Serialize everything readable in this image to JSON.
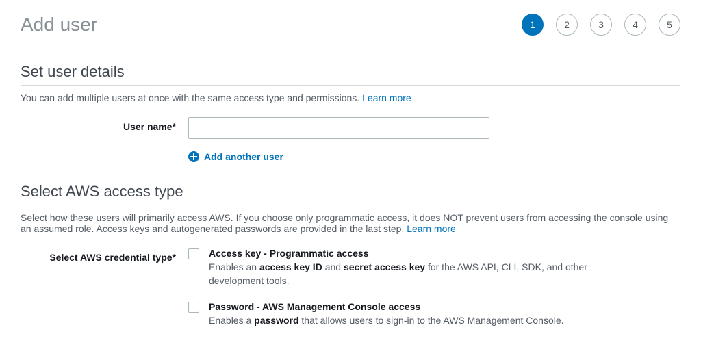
{
  "page_title": "Add user",
  "stepper": {
    "active": 1,
    "steps": [
      "1",
      "2",
      "3",
      "4",
      "5"
    ]
  },
  "user_details": {
    "title": "Set user details",
    "subtitle_prefix": "You can add multiple users at once with the same access type and permissions. ",
    "learn_more": "Learn more",
    "username_label": "User name*",
    "username_value": "",
    "add_another_label": "Add another user"
  },
  "access_type": {
    "title": "Select AWS access type",
    "subtitle_prefix": "Select how these users will primarily access AWS. If you choose only programmatic access, it does NOT prevent users from accessing the console using an assumed role. Access keys and autogenerated passwords are provided in the last step. ",
    "learn_more": "Learn more",
    "credential_label": "Select AWS credential type*",
    "option_access_key": {
      "title": "Access key - Programmatic access",
      "desc_prefix": "Enables an ",
      "desc_b1": "access key ID",
      "desc_mid": " and ",
      "desc_b2": "secret access key",
      "desc_suffix": " for the AWS API, CLI, SDK, and other development tools."
    },
    "option_password": {
      "title": "Password - AWS Management Console access",
      "desc_prefix": "Enables a ",
      "desc_b1": "password",
      "desc_suffix": " that allows users to sign-in to the AWS Management Console."
    }
  }
}
